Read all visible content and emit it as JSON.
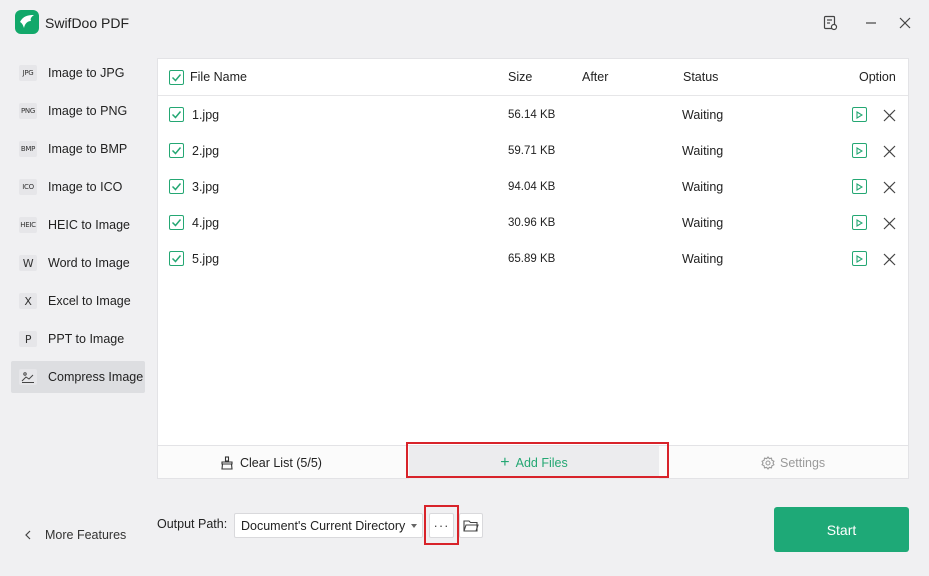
{
  "app": {
    "title": "SwifDoo PDF",
    "logo_text": "PDF"
  },
  "window_controls": {
    "feedback_icon": "feedback-icon",
    "minimize_icon": "minimize-icon",
    "close_icon": "close-icon"
  },
  "sidebar": {
    "items": [
      {
        "icon": "JPG",
        "label": "Image to JPG"
      },
      {
        "icon": "PNG",
        "label": "Image to PNG"
      },
      {
        "icon": "BMP",
        "label": "Image to BMP"
      },
      {
        "icon": "ICO",
        "label": "Image to ICO"
      },
      {
        "icon": "HEIC",
        "label": "HEIC to Image"
      },
      {
        "icon": "W",
        "label": "Word to Image"
      },
      {
        "icon": "X",
        "label": "Excel to Image"
      },
      {
        "icon": "P",
        "label": "PPT to Image"
      },
      {
        "icon": "compress",
        "label": "Compress Image"
      }
    ],
    "active": "Compress Image",
    "more_features": "More Features"
  },
  "table": {
    "headers": {
      "file_name": "File Name",
      "size": "Size",
      "after": "After",
      "status": "Status",
      "option": "Option"
    },
    "rows": [
      {
        "name": "1.jpg",
        "size": "56.14 KB",
        "after": "",
        "status": "Waiting",
        "checked": true
      },
      {
        "name": "2.jpg",
        "size": "59.71 KB",
        "after": "",
        "status": "Waiting",
        "checked": true
      },
      {
        "name": "3.jpg",
        "size": "94.04 KB",
        "after": "",
        "status": "Waiting",
        "checked": true
      },
      {
        "name": "4.jpg",
        "size": "30.96 KB",
        "after": "",
        "status": "Waiting",
        "checked": true
      },
      {
        "name": "5.jpg",
        "size": "65.89 KB",
        "after": "",
        "status": "Waiting",
        "checked": true
      }
    ]
  },
  "actions": {
    "clear_list": "Clear List (5/5)",
    "add_files": "Add Files",
    "settings": "Settings"
  },
  "output": {
    "label": "Output Path:",
    "path": "Document's Current Directory",
    "browse_dots": "···"
  },
  "start_button": "Start",
  "colors": {
    "accent": "#1ea977",
    "highlight": "#d8232a"
  }
}
